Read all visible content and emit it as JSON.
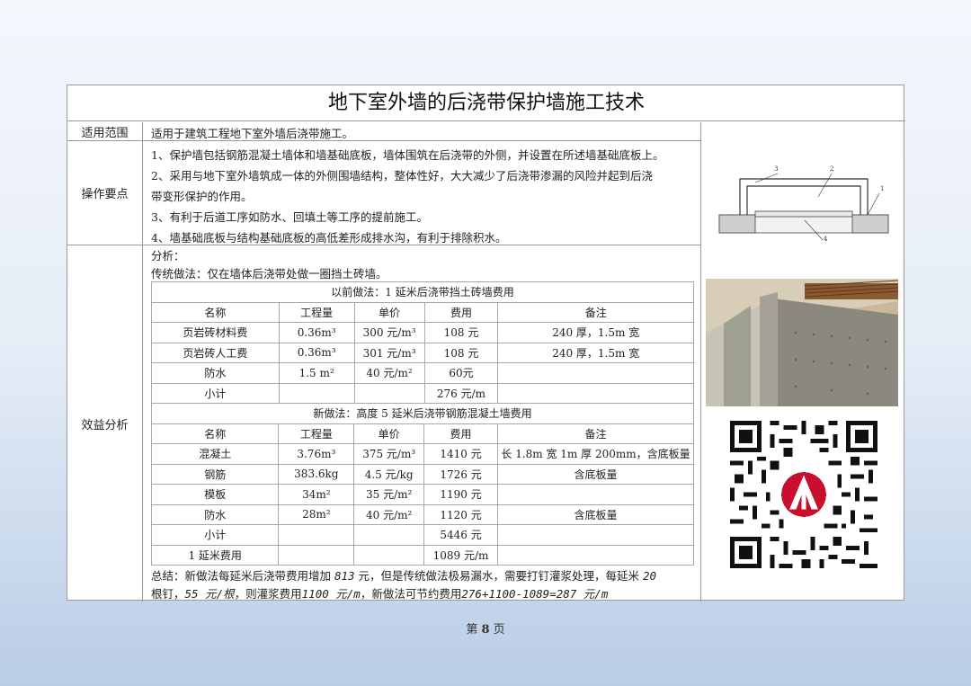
{
  "title": "地下室外墙的后浇带保护墙施工技术",
  "sections": {
    "scope": {
      "label": "适用范围",
      "text": "适用于建筑工程地下室外墙后浇带施工。"
    },
    "operation": {
      "label": "操作要点",
      "lines": [
        "1、保护墙包括钢筋混凝土墙体和墙基础底板，墙体围筑在后浇带的外侧，并设置在所述墙基础底板上。",
        "2、采用与地下室外墙筑成一体的外侧围墙结构，整体性好，大大减少了后浇带渗漏的风险并起到后浇",
        "带变形保护的作用。",
        "3、有利于后道工序如防水、回填土等工序的提前施工。",
        "4、墙基础底板与结构基础底板的高低差形成排水沟，有利于排除积水。"
      ]
    },
    "benefit": {
      "label": "效益分析",
      "analysis": "分析：",
      "traditional": "传统做法：仅在墙体后浇带处做一圈挡土砖墙。"
    }
  },
  "old_table": {
    "caption": "以前做法：1 延米后浇带挡土砖墙费用",
    "headers": [
      "名称",
      "工程量",
      "单价",
      "费用",
      "备注"
    ],
    "rows": [
      [
        "页岩砖材料费",
        "0.36m³",
        "300 元/m³",
        "108 元",
        "240 厚，1.5m 宽"
      ],
      [
        "页岩砖人工费",
        "0.36m³",
        "301 元/m³",
        "108 元",
        "240 厚，1.5m 宽"
      ],
      [
        "防水",
        "1.5 m²",
        "40 元/m²",
        "60元",
        ""
      ],
      [
        "小计",
        "",
        "",
        "276 元/m",
        ""
      ]
    ]
  },
  "new_table": {
    "caption": "新做法：高度 5 延米后浇带钢筋混凝土墙费用",
    "headers": [
      "名称",
      "工程量",
      "单价",
      "费用",
      "备注"
    ],
    "rows": [
      [
        "混凝土",
        "3.76m³",
        "375 元/m³",
        "1410 元",
        "长 1.8m 宽 1m 厚 200mm，含底板量"
      ],
      [
        "钢筋",
        "383.6kg",
        "4.5 元/kg",
        "1726 元",
        "含底板量"
      ],
      [
        "模板",
        "34m²",
        "35 元/m²",
        "1190 元",
        ""
      ],
      [
        "防水",
        "28m²",
        "40 元/m²",
        "1120 元",
        "含底板量"
      ],
      [
        "小计",
        "",
        "",
        "5446 元",
        ""
      ],
      [
        "1 延米费用",
        "",
        "",
        "1089 元/m",
        ""
      ]
    ]
  },
  "summary": {
    "line1_a": "总结：新做法每延米后浇带费用增加 ",
    "line1_b": "813",
    "line1_c": " 元，但是传统做法极易漏水，需要打钉灌浆处理，每延米 ",
    "line1_d": "20",
    "line2_a": "根钉，",
    "line2_b": "55 元/根",
    "line2_c": "，则灌浆费用",
    "line2_d": "1100 元/m",
    "line2_e": "，新做法可节约费用",
    "line2_f": "276+1100-1089=287 元/m"
  },
  "diagram_labels": [
    "3",
    "2",
    "1",
    "4"
  ],
  "page_number": {
    "prefix": "第",
    "num": "8",
    "suffix": "页"
  }
}
